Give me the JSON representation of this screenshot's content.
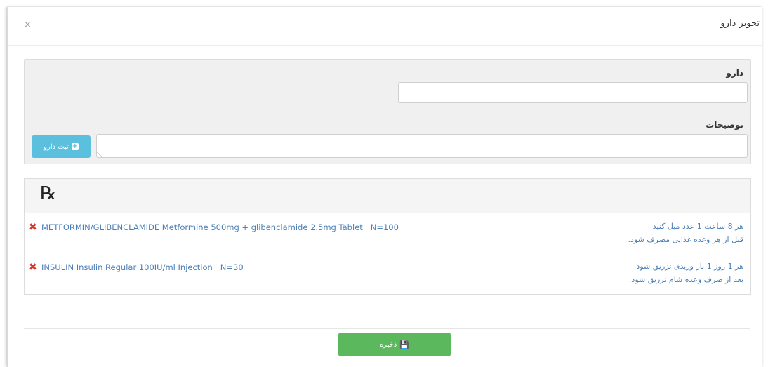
{
  "modal": {
    "title": "تجویز دارو",
    "close_icon": "close-icon",
    "close_glyph": "×"
  },
  "form": {
    "drug_label": "دارو",
    "drug_value": "",
    "desc_label": "توضیحات",
    "desc_value": "",
    "add_button_label": "ثبت دارو",
    "add_icon": "plus-icon",
    "accent_color": "#5bc0de"
  },
  "prescription": {
    "symbol": "℞",
    "items": [
      {
        "drug": "METFORMIN/GLIBENCLAMIDE Metformine 500mg + glibenclamide 2.5mg Tablet",
        "quantity": "N=100",
        "instruction_1": "هر 8 ساعت 1 عدد میل کنید",
        "instruction_2": "قبل از هر وعده غذایی مصرف شود."
      },
      {
        "drug": "INSULIN Insulin Regular 100IU/ml Injection",
        "quantity": "N=30",
        "instruction_1": "هر 1 روز 1 بار وریدی تزریق شود",
        "instruction_2": "بعد از صرف وعده شام تزریق شود."
      }
    ],
    "remove_icon": "remove-icon",
    "remove_glyph": "✖"
  },
  "footer": {
    "save_button_label": "ذخیره",
    "save_icon": "save-icon",
    "save_glyph": "💾",
    "save_color": "#5cb85c"
  }
}
